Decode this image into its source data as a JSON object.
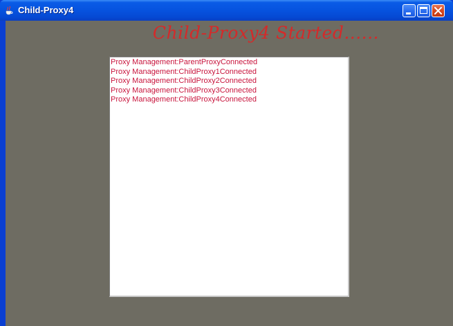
{
  "window": {
    "title": "Child-Proxy4",
    "icon": "java-cup-icon"
  },
  "titlebar_buttons": {
    "minimize": "minimize-icon",
    "maximize": "maximize-icon",
    "close": "close-icon"
  },
  "heading": "Child-Proxy4 Started......",
  "log": {
    "lines": [
      "Proxy Management:ParentProxyConnected",
      "Proxy Management:ChildProxy1Connected",
      "Proxy Management:ChildProxy2Connected",
      "Proxy Management:ChildProxy3Connected",
      "Proxy Management:ChildProxy4Connected"
    ]
  },
  "colors": {
    "titlebar": "#0653df",
    "client_background": "#6e6c62",
    "heading_text": "#d42a2a",
    "log_text": "#c8143c",
    "close_button": "#d6471e"
  }
}
